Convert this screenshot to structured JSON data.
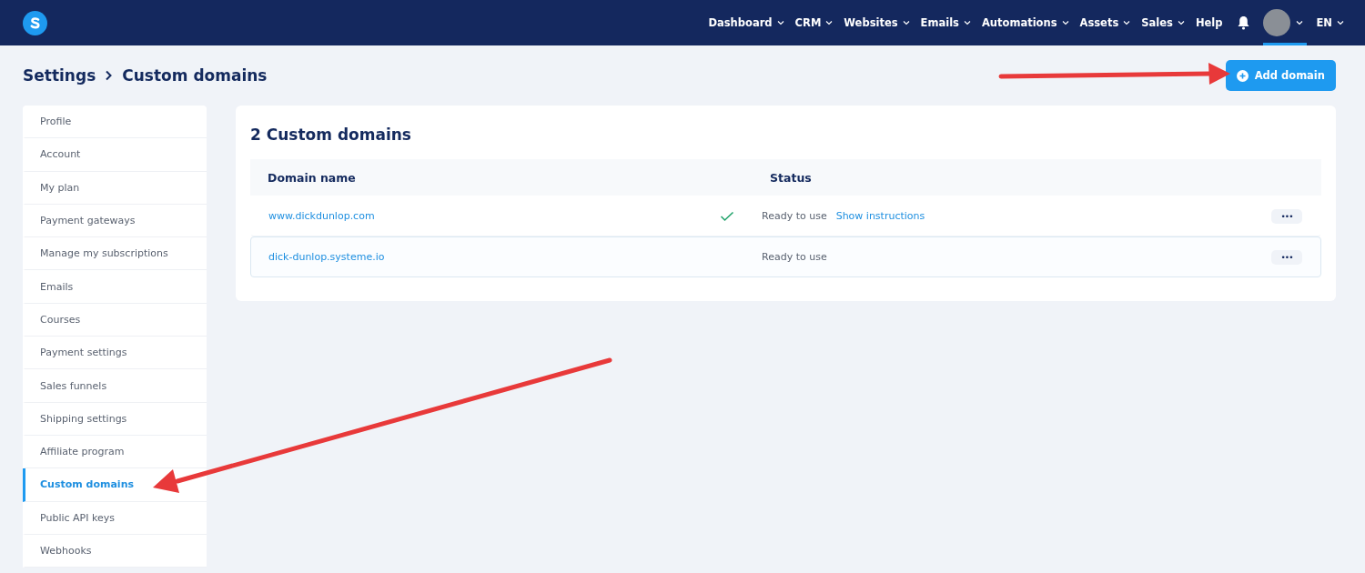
{
  "nav": {
    "items": [
      {
        "label": "Dashboard",
        "dropdown": true
      },
      {
        "label": "CRM",
        "dropdown": true
      },
      {
        "label": "Websites",
        "dropdown": true
      },
      {
        "label": "Emails",
        "dropdown": true
      },
      {
        "label": "Automations",
        "dropdown": true
      },
      {
        "label": "Assets",
        "dropdown": true
      },
      {
        "label": "Sales",
        "dropdown": true
      },
      {
        "label": "Help",
        "dropdown": false
      }
    ],
    "language": "EN"
  },
  "breadcrumb": [
    "Settings",
    "Custom domains"
  ],
  "add_button": "Add domain",
  "sidebar": {
    "items": [
      {
        "label": "Profile",
        "selected": false
      },
      {
        "label": "Account",
        "selected": false
      },
      {
        "label": "My plan",
        "selected": false
      },
      {
        "label": "Payment gateways",
        "selected": false
      },
      {
        "label": "Manage my subscriptions",
        "selected": false
      },
      {
        "label": "Emails",
        "selected": false
      },
      {
        "label": "Courses",
        "selected": false
      },
      {
        "label": "Payment settings",
        "selected": false
      },
      {
        "label": "Sales funnels",
        "selected": false
      },
      {
        "label": "Shipping settings",
        "selected": false
      },
      {
        "label": "Affiliate program",
        "selected": false
      },
      {
        "label": "Custom domains",
        "selected": true
      },
      {
        "label": "Public API keys",
        "selected": false
      },
      {
        "label": "Webhooks",
        "selected": false
      }
    ]
  },
  "card": {
    "title": "2 Custom domains",
    "table": {
      "columns": [
        "Domain name",
        "Status"
      ],
      "rows": [
        {
          "domain": "www.dickdunlop.com",
          "verified": true,
          "status": "Ready to use",
          "link": "Show instructions",
          "menu": "•••",
          "hovered": false
        },
        {
          "domain": "dick-dunlop.systeme.io",
          "verified": false,
          "status": "Ready to use",
          "menu": "•••",
          "hovered": true
        }
      ]
    }
  }
}
